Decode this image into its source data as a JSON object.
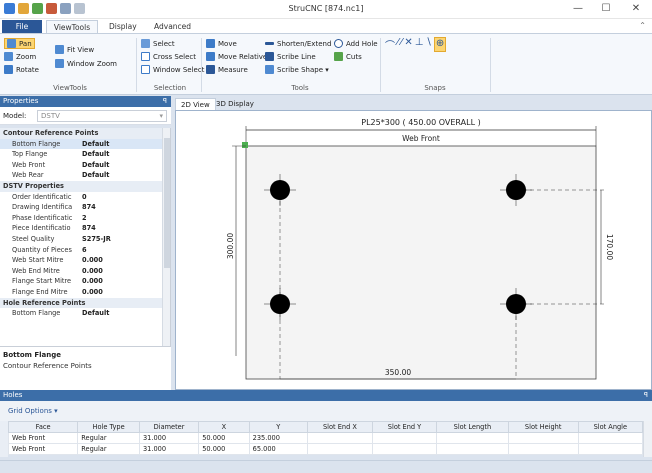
{
  "window": {
    "title": "StruCNC [874.nc1]",
    "minimize": "—",
    "maximize": "☐",
    "close": "✕"
  },
  "ribbon_tabs": [
    "File",
    "ViewTools",
    "Display",
    "Advanced"
  ],
  "ribbon": {
    "viewtools_group": {
      "label": "ViewTools",
      "pan": "Pan",
      "zoom": "Zoom",
      "rotate": "Rotate",
      "fit_view": "Fit View",
      "window_zoom": "Window Zoom"
    },
    "selection_group": {
      "label": "Selection",
      "select": "Select",
      "cross_select": "Cross Select",
      "window_select": "Window Select"
    },
    "tools_group": {
      "label": "Tools",
      "move": "Move",
      "move_relative": "Move Relative",
      "measure": "Measure",
      "shorten_extend": "Shorten/Extend",
      "scribe_line": "Scribe Line",
      "scribe_shape": "Scribe Shape ▾",
      "add_hole": "Add Hole",
      "cuts": "Cuts"
    },
    "snaps_group": {
      "label": "Snaps"
    }
  },
  "properties": {
    "header": "Properties",
    "pin": "ꟼ",
    "model_label": "Model:",
    "model_value": "DSTV",
    "rows": [
      {
        "type": "section",
        "label": "Contour Reference Points"
      },
      {
        "type": "row",
        "key": "Bottom Flange",
        "value": "Default",
        "selected": true
      },
      {
        "type": "row",
        "key": "Top Flange",
        "value": "Default"
      },
      {
        "type": "row",
        "key": "Web Front",
        "value": "Default"
      },
      {
        "type": "row",
        "key": "Web Rear",
        "value": "Default"
      },
      {
        "type": "section",
        "label": "DSTV Properties"
      },
      {
        "type": "row",
        "key": "Order Identificatic",
        "value": "0"
      },
      {
        "type": "row",
        "key": "Drawing Identifica",
        "value": "874"
      },
      {
        "type": "row",
        "key": "Phase Identificatic",
        "value": "2"
      },
      {
        "type": "row",
        "key": "Piece Identificatio",
        "value": "874"
      },
      {
        "type": "row",
        "key": "Steel Quality",
        "value": "S275-JR"
      },
      {
        "type": "row",
        "key": "Quantity of Pieces",
        "value": "6"
      },
      {
        "type": "row",
        "key": "Web Start Mitre",
        "value": "0.000"
      },
      {
        "type": "row",
        "key": "Web End Mitre",
        "value": "0.000"
      },
      {
        "type": "row",
        "key": "Flange Start Mitre",
        "value": "0.000"
      },
      {
        "type": "row",
        "key": "Flange End Mitre",
        "value": "0.000"
      },
      {
        "type": "section",
        "label": "Hole Reference Points"
      },
      {
        "type": "row",
        "key": "Bottom Flange",
        "value": "Default"
      }
    ],
    "desc_title": "Bottom Flange",
    "desc_text": "Contour Reference Points"
  },
  "view_tabs": [
    "2D View",
    "3D Display"
  ],
  "drawing": {
    "title": "PL25*300 ( 450.00 OVERALL )",
    "face": "Web Front",
    "dim_height": "300.00",
    "dim_hole_vertical": "170.00",
    "dim_hole_horizontal": "350.00"
  },
  "holes": {
    "header": "Holes",
    "pin": "ꟼ",
    "grid_options": "Grid Options ▾",
    "columns": [
      "Face",
      "Hole Type",
      "Diameter",
      "X",
      "Y",
      "Slot End X",
      "Slot End Y",
      "Slot Length",
      "Slot Height",
      "Slot Angle"
    ],
    "rows": [
      [
        "Web Front",
        "Regular",
        "31.000",
        "50.000",
        "235.000",
        "",
        "",
        "",
        "",
        ""
      ],
      [
        "Web Front",
        "Regular",
        "31.000",
        "50.000",
        "65.000",
        "",
        "",
        "",
        "",
        ""
      ]
    ]
  },
  "colors": {
    "accent": "#2b5797",
    "panel_header": "#3c6ea8",
    "selected_tool": "#fcd572"
  }
}
